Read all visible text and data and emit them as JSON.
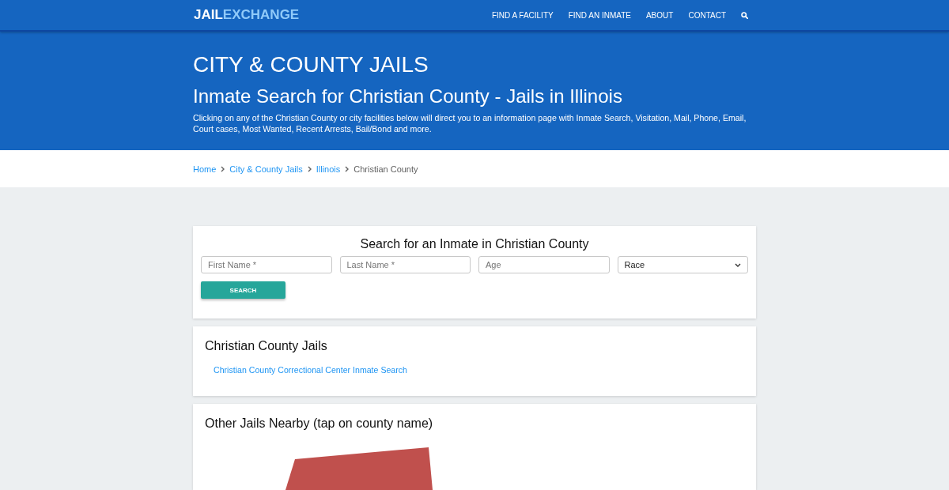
{
  "header": {
    "logo": {
      "primary": "JAIL",
      "accent": "EXCHANGE"
    },
    "nav": [
      {
        "label": "FIND A FACILITY"
      },
      {
        "label": "FIND AN INMATE"
      },
      {
        "label": "ABOUT"
      },
      {
        "label": "CONTACT"
      }
    ]
  },
  "hero": {
    "kicker": "CITY & COUNTY JAILS",
    "title": "Inmate Search for Christian County - Jails in Illinois",
    "description": "Clicking on any of the Christian County or city facilities below will direct you to an information page with Inmate Search, Visitation, Mail, Phone, Email, Court cases, Most Wanted, Recent Arrests, Bail/Bond and more."
  },
  "breadcrumb": [
    {
      "label": "Home",
      "current": false
    },
    {
      "label": "City & County Jails",
      "current": false
    },
    {
      "label": "Illinois",
      "current": false
    },
    {
      "label": "Christian County",
      "current": true
    }
  ],
  "search_form": {
    "title": "Search for an Inmate in Christian County",
    "fields": [
      {
        "kind": "text",
        "placeholder": "First Name *"
      },
      {
        "kind": "text",
        "placeholder": "Last Name *"
      },
      {
        "kind": "text",
        "placeholder": "Age"
      },
      {
        "kind": "select",
        "value": "Race"
      }
    ],
    "button": "SEARCH"
  },
  "county_jails": {
    "title": "Christian County Jails",
    "links": [
      "Christian County Correctional Center Inmate Search"
    ]
  },
  "nearby": {
    "title": "Other Jails Nearby (tap on county name)"
  }
}
